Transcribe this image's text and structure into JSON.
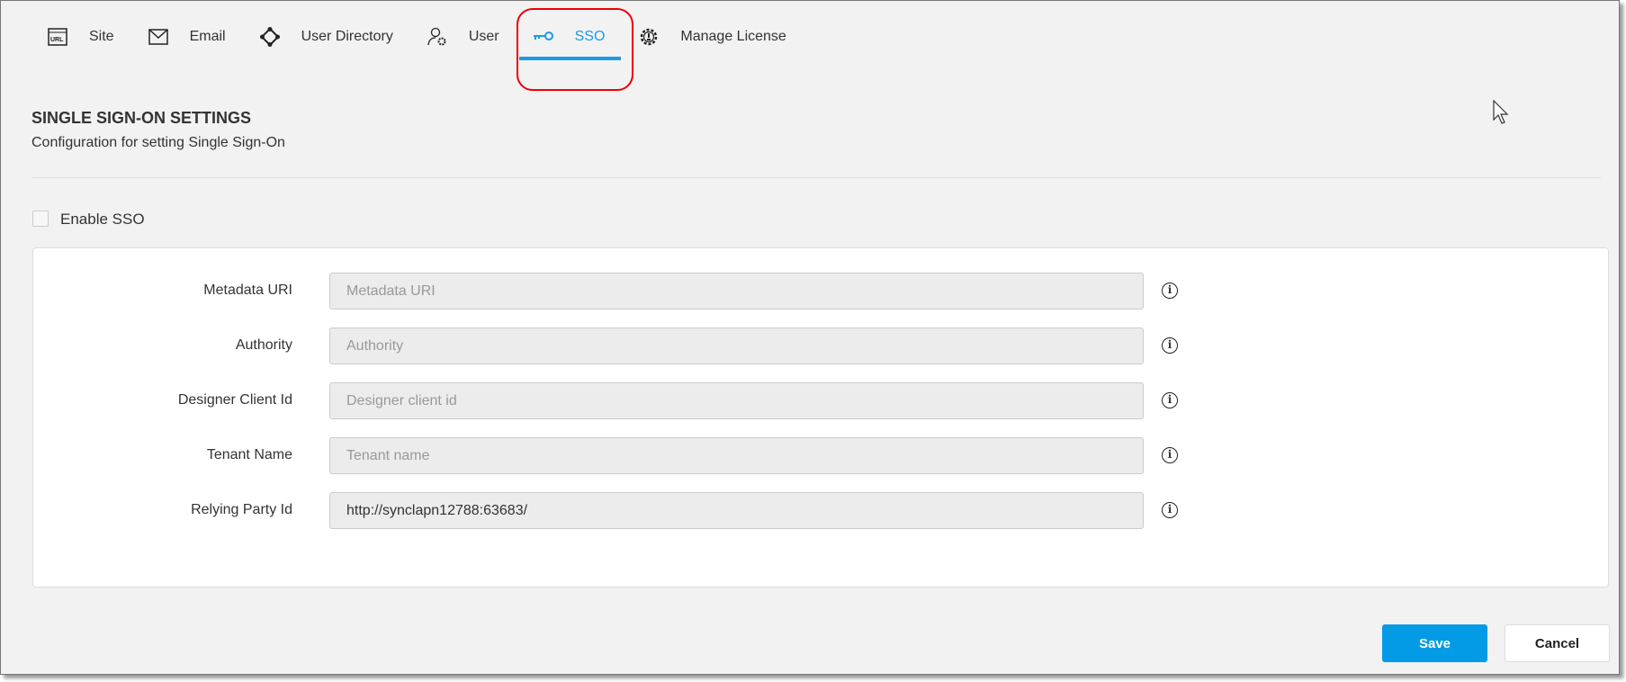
{
  "tabs": [
    {
      "label": "Site",
      "icon": "url-icon"
    },
    {
      "label": "Email",
      "icon": "envelope-icon"
    },
    {
      "label": "User Directory",
      "icon": "directory-icon"
    },
    {
      "label": "User",
      "icon": "user-gear-icon"
    },
    {
      "label": "SSO",
      "icon": "key-icon",
      "active": true
    },
    {
      "label": "Manage License",
      "icon": "license-gear-icon"
    }
  ],
  "header": {
    "title": "SINGLE SIGN-ON SETTINGS",
    "subtitle": "Configuration for setting Single Sign-On"
  },
  "enable_sso": {
    "label": "Enable SSO",
    "checked": false
  },
  "fields": [
    {
      "label": "Metadata URI",
      "placeholder": "Metadata URI",
      "value": ""
    },
    {
      "label": "Authority",
      "placeholder": "Authority",
      "value": ""
    },
    {
      "label": "Designer Client Id",
      "placeholder": "Designer client id",
      "value": ""
    },
    {
      "label": "Tenant Name",
      "placeholder": "Tenant name",
      "value": ""
    },
    {
      "label": "Relying Party Id",
      "placeholder": "",
      "value": "http://synclapn12788:63683/"
    }
  ],
  "buttons": {
    "save": "Save",
    "cancel": "Cancel"
  },
  "colors": {
    "accent": "#1a9be6",
    "save": "#039be5",
    "highlight": "#ee0000"
  }
}
